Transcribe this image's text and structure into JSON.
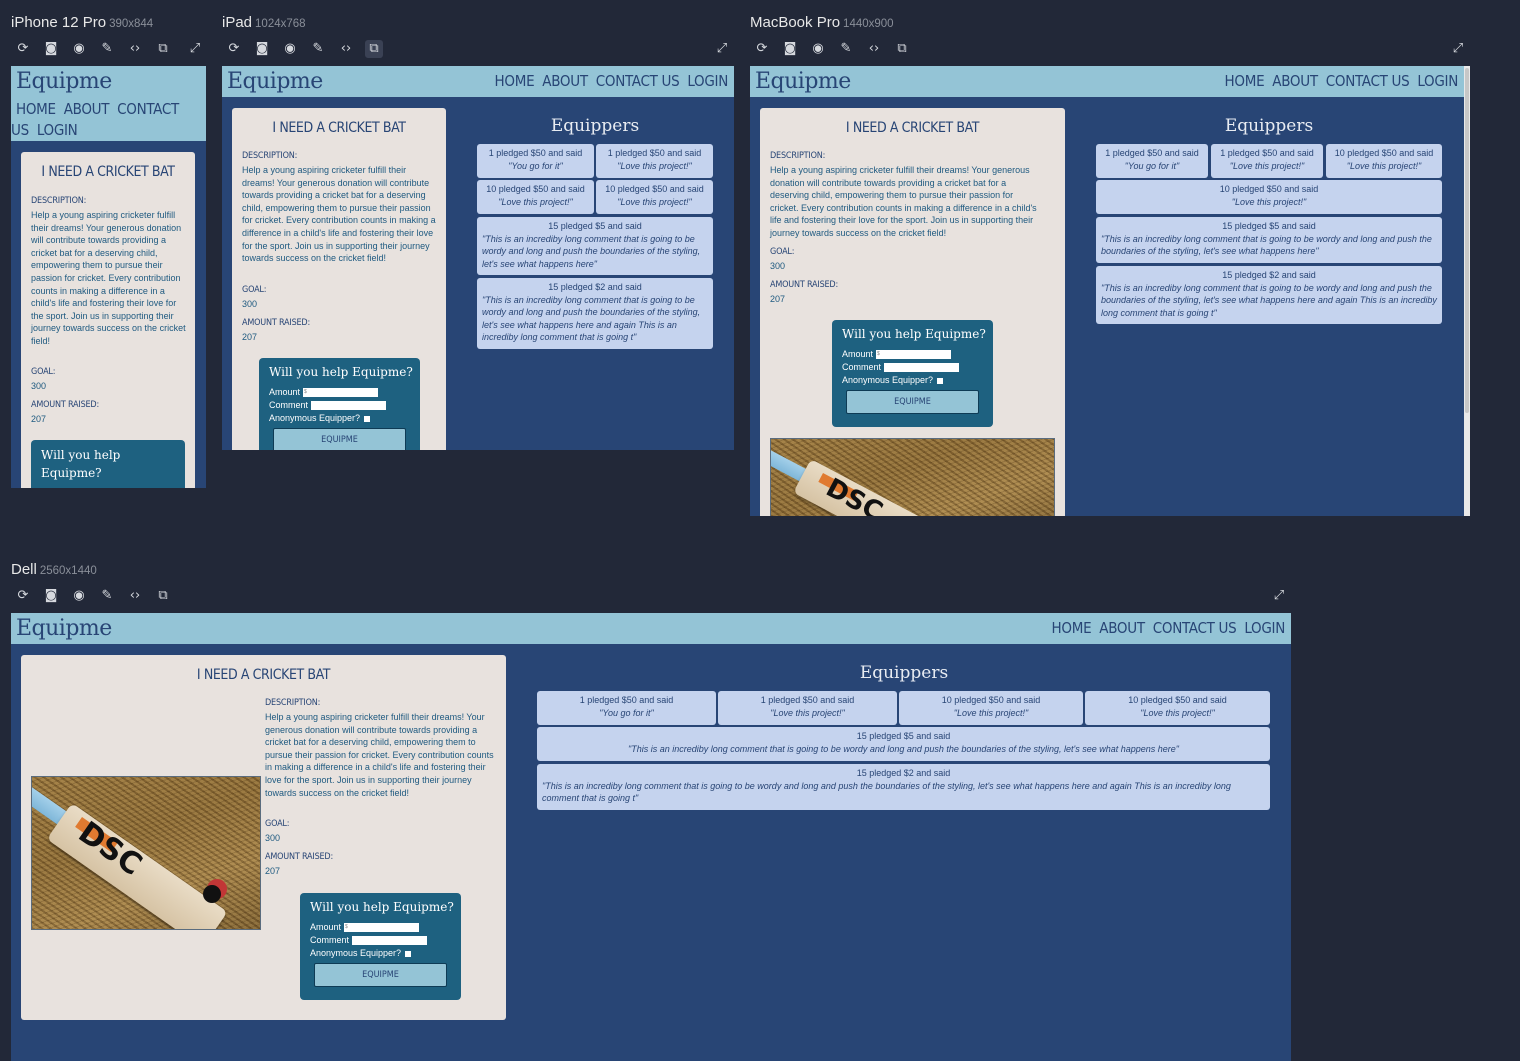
{
  "toolbar_icons": [
    "refresh-icon",
    "screenshot-edit-icon",
    "camera-icon",
    "eyedropper-icon",
    "code-icon",
    "rotate-device-icon",
    "fullscreen-icon"
  ],
  "devices": {
    "iphone": {
      "name": "iPhone 12 Pro",
      "dims": "390x844"
    },
    "ipad": {
      "name": "iPad",
      "dims": "1024x768"
    },
    "macbook": {
      "name": "MacBook Pro",
      "dims": "1440x900"
    },
    "dell": {
      "name": "Dell",
      "dims": "2560x1440"
    }
  },
  "site": {
    "logo": "Equipme",
    "nav": [
      "HOME",
      "ABOUT",
      "CONTACT US",
      "LOGIN"
    ],
    "nav_iphone_line1": "HOME  ABOUT  CONTACT",
    "nav_iphone_line2": "US  LOGIN",
    "project": {
      "title": "I NEED A CRICKET BAT",
      "description_label": "DESCRIPTION:",
      "description": "Help a young aspiring cricketer fulfill their dreams! Your generous donation will contribute towards providing a cricket bat for a deserving child, empowering them to pursue their passion for cricket. Every contribution counts in making a difference in a child's life and fostering their love for the sport. Join us in supporting their journey towards success on the cricket field!",
      "goal_label": "GOAL:",
      "goal": "300",
      "raised_label": "AMOUNT RAISED:",
      "raised": "207"
    },
    "donate": {
      "heading": "Will you help Equipme?",
      "heading_l1": "Will you help",
      "heading_l2": "Equipme?",
      "amount_label": "Amount",
      "amount_placeholder": "$",
      "comment_label": "Comment",
      "anon_label": "Anonymous Equipper?",
      "button": "EQUIPME"
    },
    "equippers_title": "Equippers",
    "pledges": [
      {
        "who": "1 pledged $50 and said",
        "comment": "\"You go for it\""
      },
      {
        "who": "1 pledged $50 and said",
        "comment": "\"Love this project!\""
      },
      {
        "who": "10 pledged $50 and said",
        "comment": "\"Love this project!\""
      },
      {
        "who": "10 pledged $50 and said",
        "comment": "\"Love this project!\""
      },
      {
        "who": "15 pledged $5 and said",
        "comment": "\"This is an incrediby long comment that is going to be wordy and long and push the boundaries of the styling, let's see what happens here\""
      },
      {
        "who": "15 pledged $2 and said",
        "comment": "\"This is an incrediby long comment that is going to be wordy and long and push the boundaries of the styling, let's see what happens here and again This is an incrediby long comment that is going t\""
      }
    ]
  },
  "colors": {
    "navy": "#284575",
    "light_blue": "#94c4d6",
    "card": "#e8e2de",
    "teal": "#1e6180",
    "pledge_bg": "#c5d3ee",
    "page_bg": "#222838"
  }
}
